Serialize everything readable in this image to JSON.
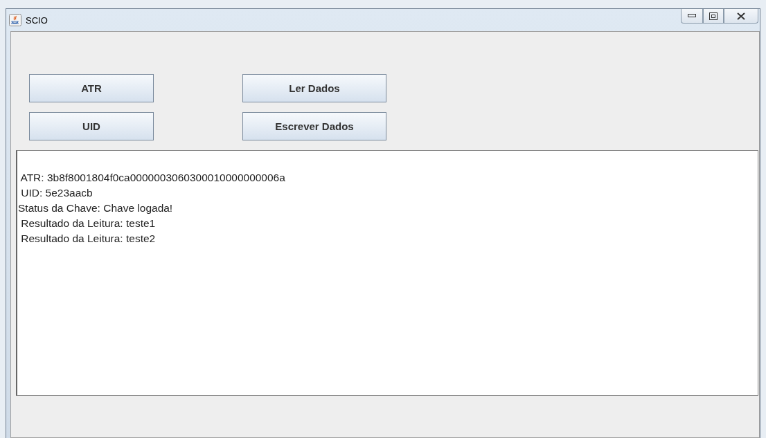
{
  "window": {
    "title": "SCIO"
  },
  "buttons": [
    {
      "label": "ATR"
    },
    {
      "label": "Ler Dados"
    },
    {
      "label": "UID"
    },
    {
      "label": "Escrever Dados"
    }
  ],
  "output_lines": [
    " ATR: 3b8f8001804f0ca0000003060300010000000006a",
    " UID: 5e23aacb",
    "Status da Chave: Chave logada!",
    " Resultado da Leitura: teste1",
    " Resultado da Leitura: teste2"
  ]
}
